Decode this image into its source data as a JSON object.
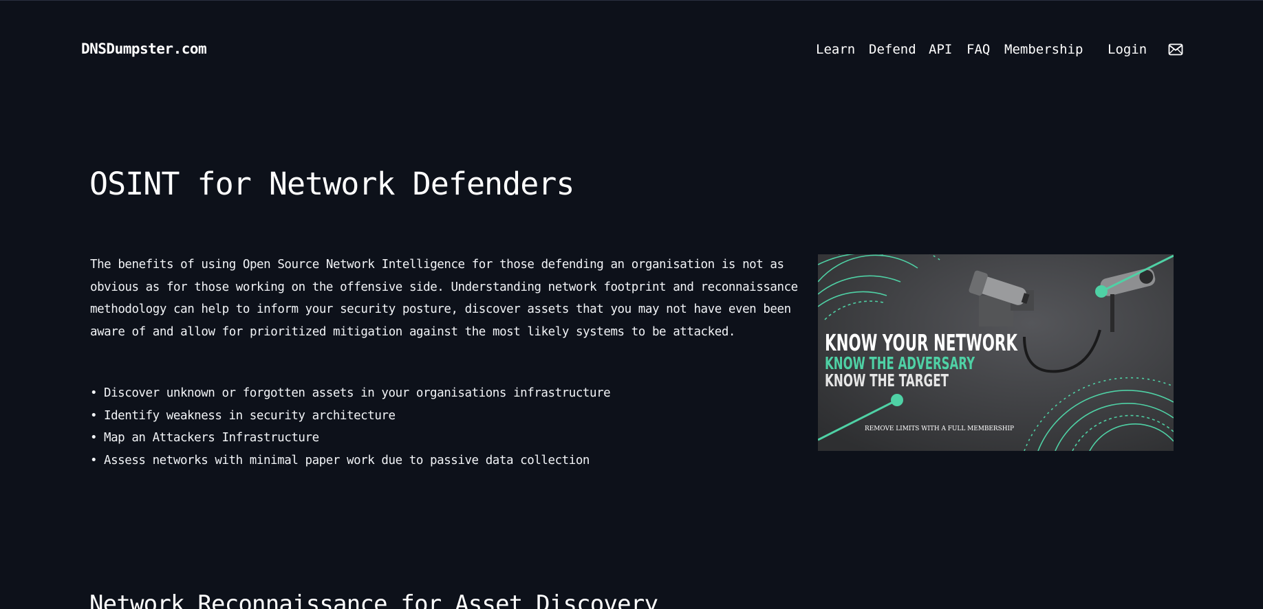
{
  "header": {
    "brand": "DNSDumpster.com",
    "nav": [
      {
        "id": "learn",
        "label": "Learn"
      },
      {
        "id": "defend",
        "label": "Defend"
      },
      {
        "id": "api",
        "label": "API"
      },
      {
        "id": "faq",
        "label": "FAQ"
      },
      {
        "id": "membership",
        "label": "Membership"
      },
      {
        "id": "login",
        "label": "Login"
      }
    ],
    "mail_icon": "envelope-icon"
  },
  "main": {
    "title": "OSINT for Network Defenders",
    "intro": "The benefits of using Open Source Network Intelligence for those defending an organisation is not as obvious as for those working on the offensive side. Understanding network footprint and reconnaissance methodology can help to inform your security posture, discover assets that you may not have even been aware of and allow for prioritized mitigation against the most likely systems to be attacked.",
    "benefits": [
      "Discover unknown or forgotten assets in your organisations infrastructure",
      "Identify weakness in security architecture",
      "Map an Attackers Infrastructure",
      "Assess networks with minimal paper work due to passive data collection"
    ],
    "promo": {
      "line1": "KNOW YOUR NETWORK",
      "line2": "KNOW THE ADVERSARY",
      "line3": "KNOW THE TARGET",
      "tagline": "REMOVE LIMITS WITH A FULL MEMBERSHIP",
      "accent_color": "#4fd1a5"
    },
    "next_section_title": "Network Reconnaissance for Asset Discovery"
  },
  "colors": {
    "background": "#0d111a",
    "text": "#f2f4f7",
    "accent": "#4fd1a5"
  }
}
